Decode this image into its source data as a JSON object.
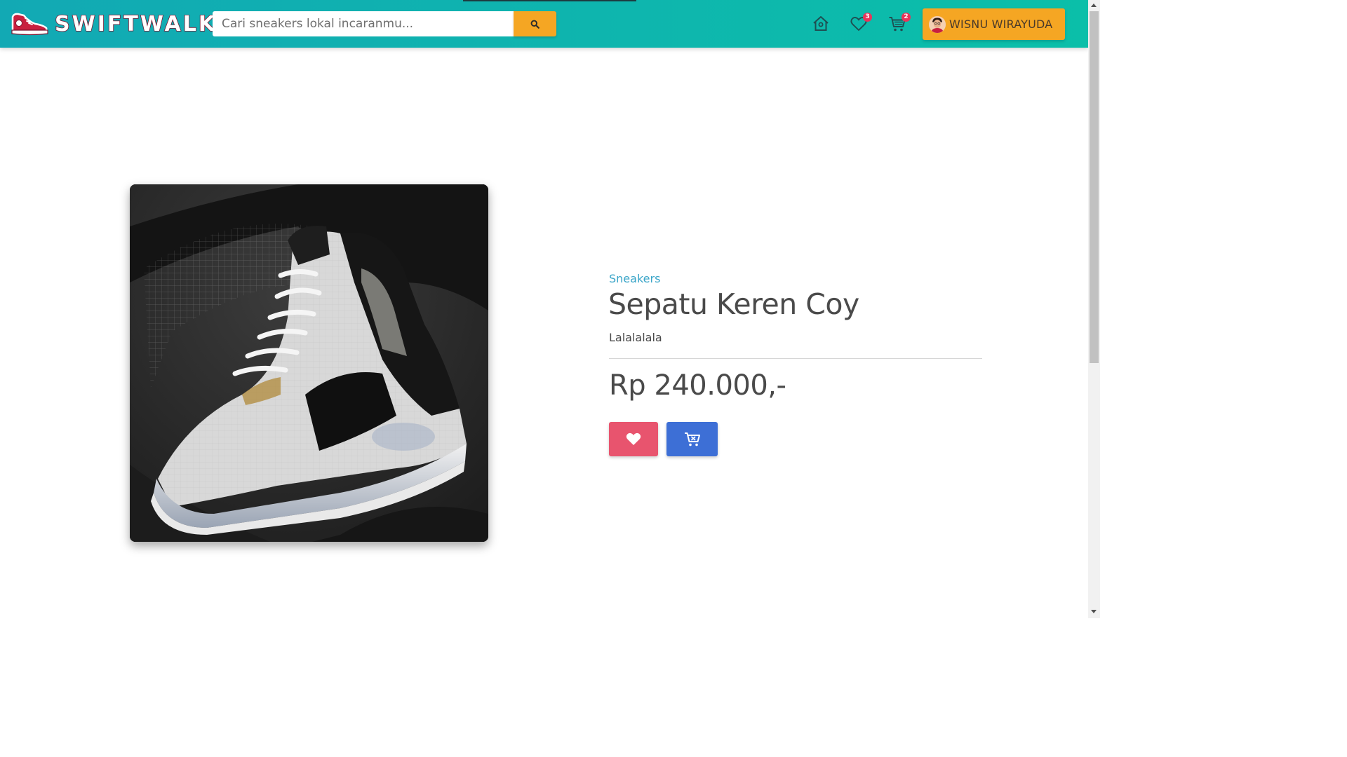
{
  "brand": {
    "name": "SWIFTWALK",
    "icon": "sneaker-logo-icon"
  },
  "search": {
    "placeholder": "Cari sneakers lokal incaranmu...",
    "value": "",
    "button_icon": "search-icon"
  },
  "nav": {
    "home_icon": "home-icon",
    "wishlist": {
      "icon": "heart-outline-icon",
      "count": "3"
    },
    "cart": {
      "icon": "cart-icon",
      "count": "2"
    },
    "user": {
      "name": "WISNU WIRAYUDA",
      "avatar": "avatar"
    }
  },
  "product": {
    "category": "Sneakers",
    "name": "Sepatu Keren Coy",
    "description": "Lalalalala",
    "price": "Rp 240.000,-",
    "image": "basketball-sneaker-photo",
    "actions": {
      "wishlist_icon": "heart-icon",
      "cart_icon": "add-to-cart-icon"
    }
  },
  "colors": {
    "navbar_start": "#12a9b4",
    "navbar_end": "#0bbfa9",
    "accent_orange": "#f5a623",
    "wishlist_button": "#e8546e",
    "cart_button": "#3d6fd6",
    "category_link": "#3aa5c8",
    "badge": "#e8345a"
  }
}
